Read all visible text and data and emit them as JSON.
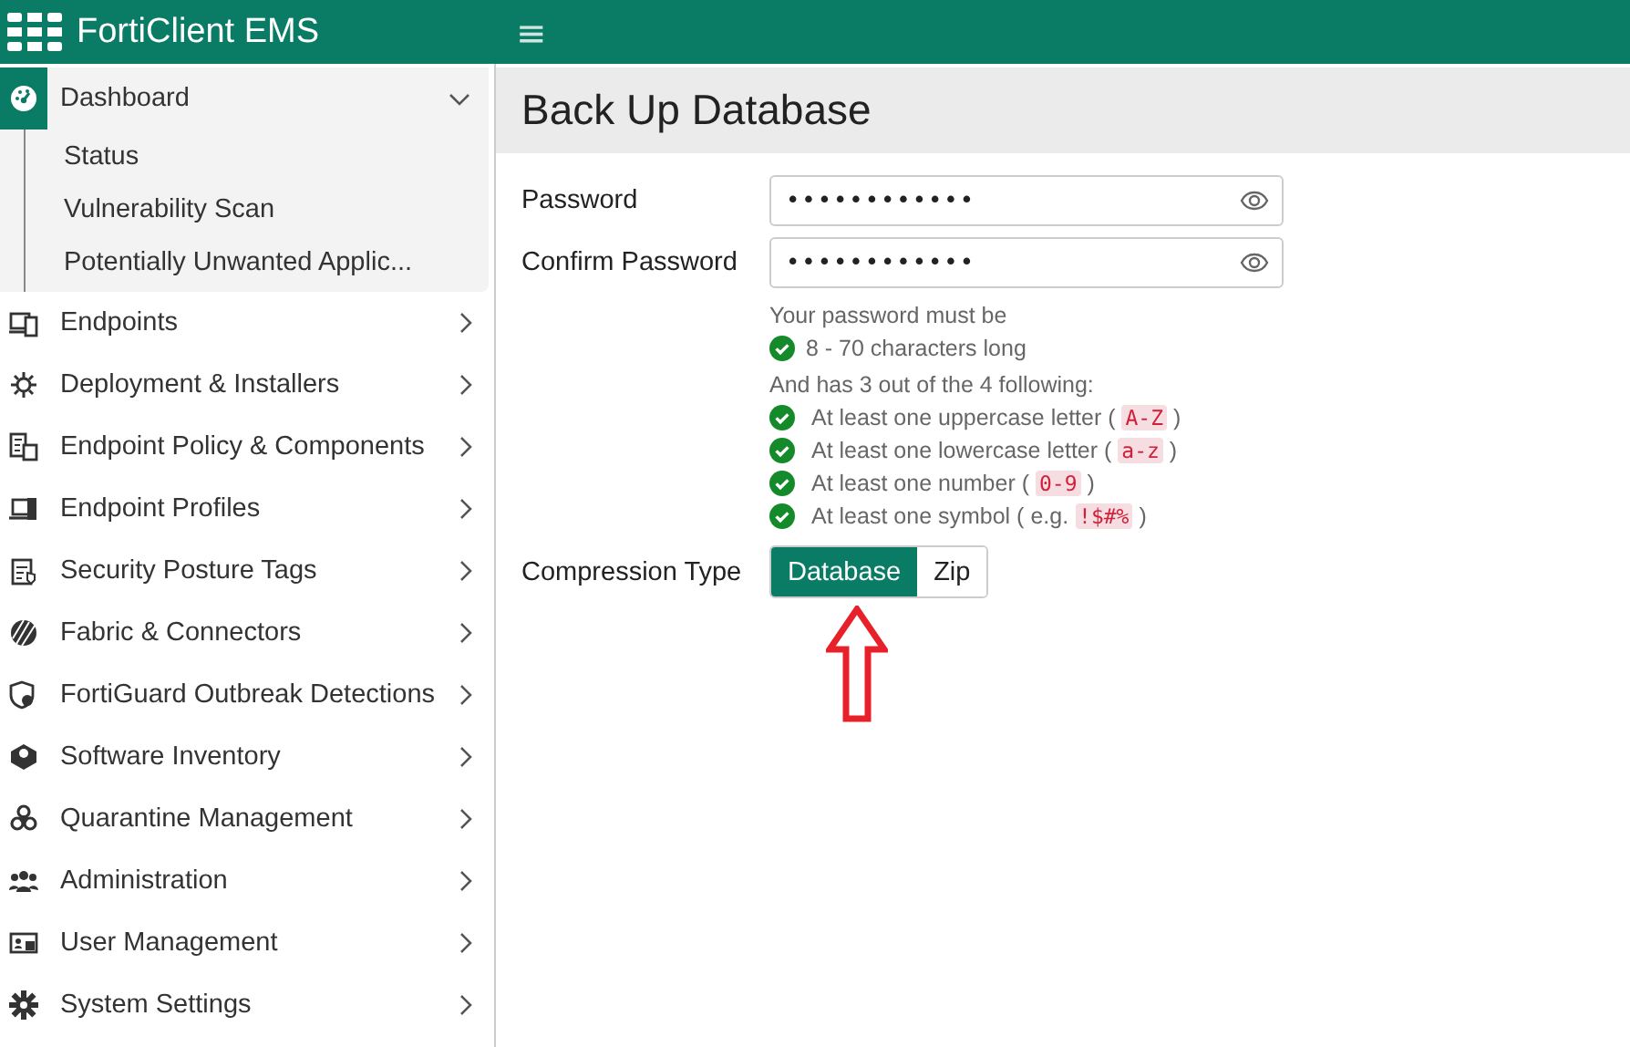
{
  "header": {
    "product": "FortiClient EMS",
    "menu_glyph": "≡"
  },
  "sidebar": {
    "items": [
      {
        "label": "Dashboard",
        "expanded": true,
        "selected": true,
        "children": [
          {
            "label": "Status"
          },
          {
            "label": "Vulnerability Scan"
          },
          {
            "label": "Potentially Unwanted Applic..."
          }
        ]
      },
      {
        "label": "Endpoints",
        "expanded": false,
        "selected": false
      },
      {
        "label": "Deployment & Installers",
        "expanded": false,
        "selected": false
      },
      {
        "label": "Endpoint Policy & Components",
        "expanded": false,
        "selected": false
      },
      {
        "label": "Endpoint Profiles",
        "expanded": false,
        "selected": false
      },
      {
        "label": "Security Posture Tags",
        "expanded": false,
        "selected": false
      },
      {
        "label": "Fabric & Connectors",
        "expanded": false,
        "selected": false
      },
      {
        "label": "FortiGuard Outbreak Detections",
        "expanded": false,
        "selected": false
      },
      {
        "label": "Software Inventory",
        "expanded": false,
        "selected": false
      },
      {
        "label": "Quarantine Management",
        "expanded": false,
        "selected": false
      },
      {
        "label": "Administration",
        "expanded": false,
        "selected": false
      },
      {
        "label": "User Management",
        "expanded": false,
        "selected": false
      },
      {
        "label": "System Settings",
        "expanded": false,
        "selected": false
      }
    ]
  },
  "page": {
    "title": "Back Up Database",
    "fields": [
      {
        "label": "Password",
        "value": "••••••••••••"
      },
      {
        "label": "Confirm Password",
        "value": "••••••••••••"
      }
    ],
    "rules_intro": "Your password must be",
    "length_rule": {
      "text": "8 - 70 characters long",
      "checked": true
    },
    "rules_heading": "And has 3 out of the 4 following:",
    "rules": [
      {
        "text": "At least one uppercase letter (",
        "code": "A-Z",
        "suffix": ")",
        "checked": true
      },
      {
        "text": "At least one lowercase letter (",
        "code": "a-z",
        "suffix": ")",
        "checked": true
      },
      {
        "text": "At least one number (",
        "code": "0-9",
        "suffix": ")",
        "checked": true
      },
      {
        "text": "At least one symbol ( e.g.",
        "code": "!$#%",
        "suffix": ")",
        "checked": true
      }
    ],
    "compression": {
      "label": "Compression Type",
      "options": [
        {
          "label": "Database",
          "selected": true
        },
        {
          "label": "Zip",
          "selected": false
        }
      ]
    }
  }
}
